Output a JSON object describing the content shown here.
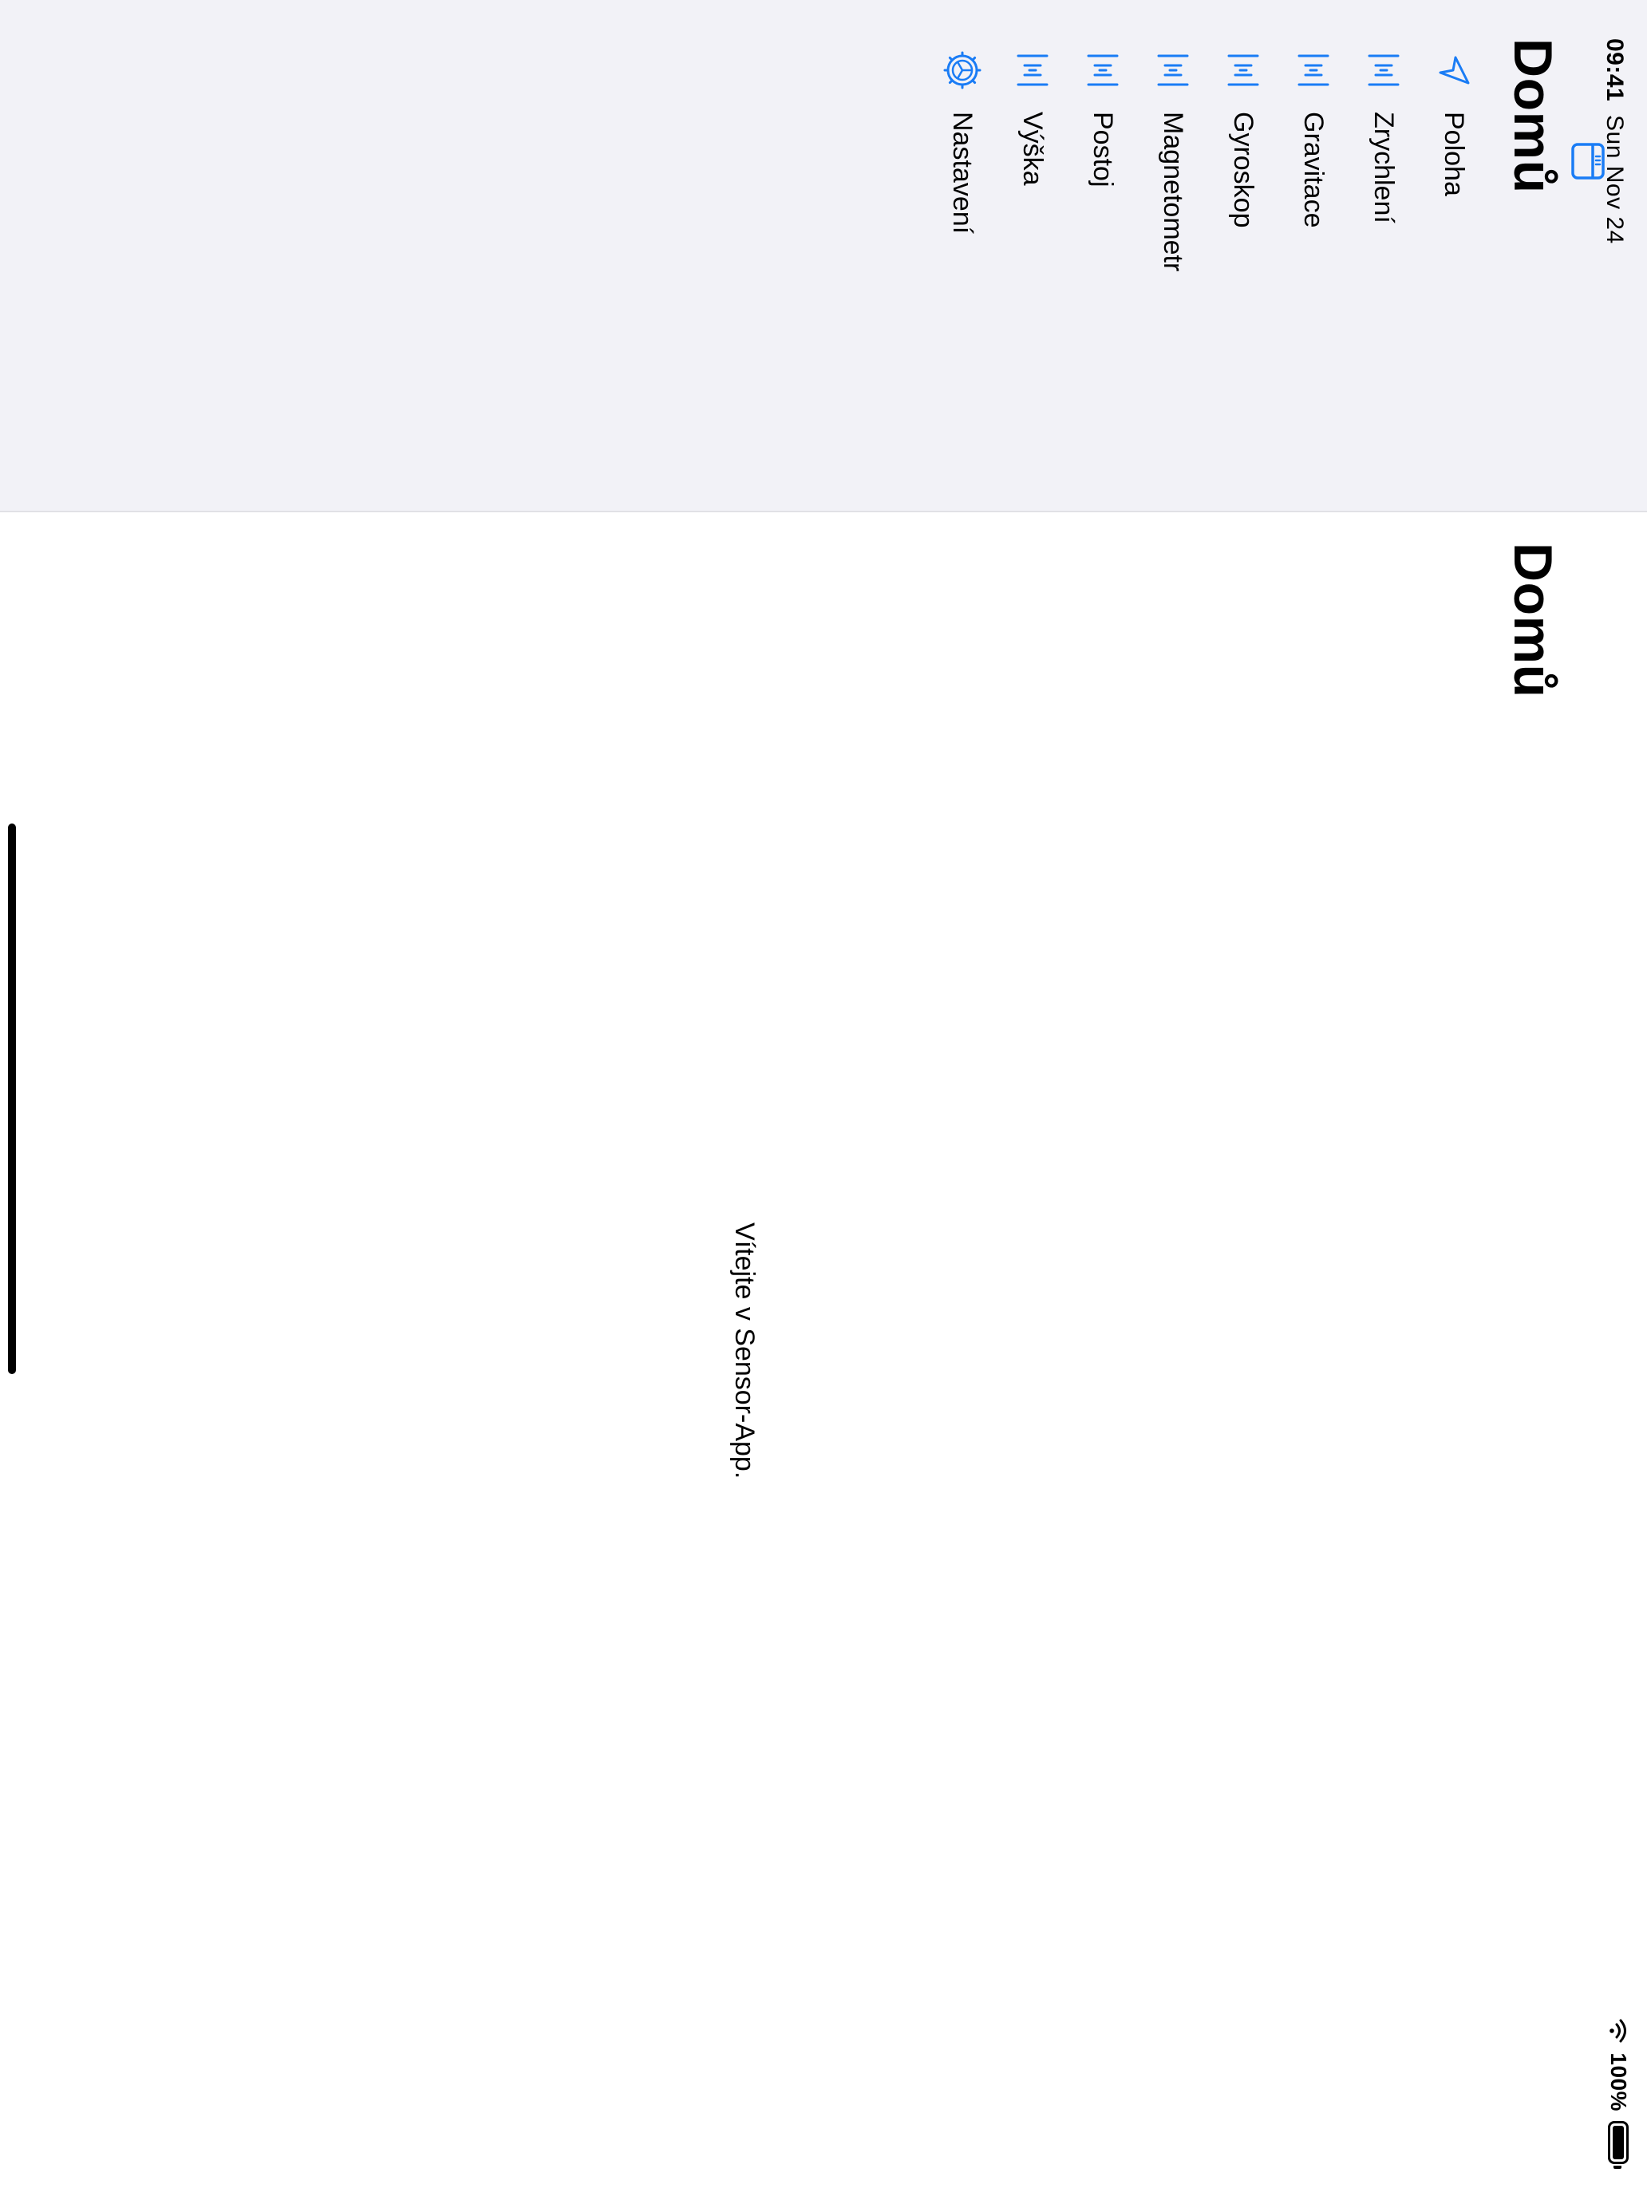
{
  "status_bar": {
    "time": "09:41",
    "date": "Sun Nov 24",
    "battery_percent": "100%"
  },
  "sidebar": {
    "title": "Domů",
    "toggle_icon": "sidebar-icon",
    "items": [
      {
        "label": "Poloha",
        "icon": "location-arrow-icon"
      },
      {
        "label": "Zrychlení",
        "icon": "sensor-icon"
      },
      {
        "label": "Gravitace",
        "icon": "sensor-icon"
      },
      {
        "label": "Gyroskop",
        "icon": "sensor-icon"
      },
      {
        "label": "Magnetometr",
        "icon": "sensor-icon"
      },
      {
        "label": "Postoj",
        "icon": "sensor-icon"
      },
      {
        "label": "Výška",
        "icon": "sensor-icon"
      },
      {
        "label": "Nastavení",
        "icon": "gear-icon"
      }
    ]
  },
  "detail": {
    "title": "Domů",
    "welcome": "Vítejte v Sensor-App."
  },
  "colors": {
    "accent": "#1a7cf5",
    "sidebar_bg": "#f2f2f7",
    "content_bg": "#ffffff"
  }
}
